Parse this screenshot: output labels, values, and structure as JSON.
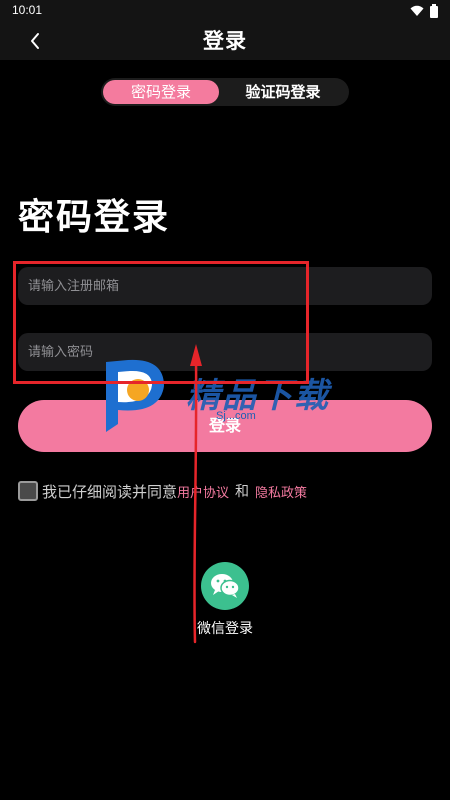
{
  "status_bar": {
    "time": "10:01"
  },
  "nav": {
    "title": "登录"
  },
  "tabs": {
    "password_login": "密码登录",
    "code_login": "验证码登录"
  },
  "heading": "密码登录",
  "form": {
    "email_placeholder": "请输入注册邮箱",
    "email_value": "",
    "password_placeholder": "请输入密码",
    "password_value": "",
    "login_button": "登录"
  },
  "agreement": {
    "checked": false,
    "text": "我已仔细阅读并同意",
    "user_agreement": "用户协议",
    "and": "和",
    "privacy_policy": "隐私政策"
  },
  "wechat": {
    "label": "微信登录",
    "icon": "wechat-icon"
  },
  "watermark": {
    "brand": "精品下载",
    "url": "Sj...com"
  },
  "colors": {
    "accent": "#f37aa0",
    "wechat": "#3cc08f",
    "annotation": "#e6252a"
  }
}
